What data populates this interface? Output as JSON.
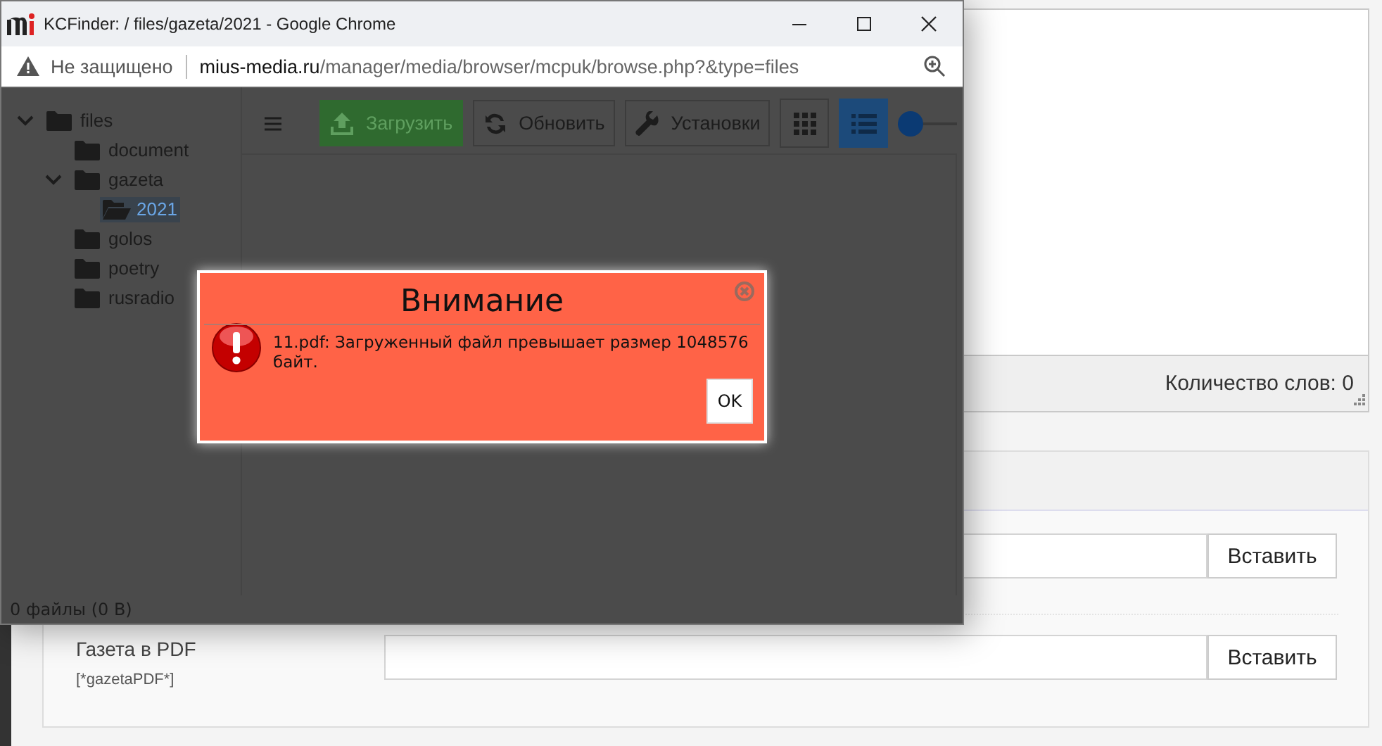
{
  "page": {
    "word_count": "Количество слов: 0",
    "fields": [
      {
        "button": "Вставить"
      },
      {
        "label": "Газета в PDF",
        "tag": "[*gazetaPDF*]",
        "button": "Вставить"
      }
    ]
  },
  "popup": {
    "title": "KCFinder: / files/gazeta/2021 - Google Chrome",
    "security": "Не защищено",
    "url_host": "mius-media.ru",
    "url_path": "/manager/media/browser/mcpuk/browse.php?&type=files",
    "tree": [
      {
        "label": "files",
        "expanded": true,
        "selected": false,
        "children": [
          {
            "label": "document",
            "selected": false
          },
          {
            "label": "gazeta",
            "expanded": true,
            "selected": false,
            "children": [
              {
                "label": "2021",
                "selected": true
              }
            ]
          },
          {
            "label": "golos",
            "selected": false
          },
          {
            "label": "poetry",
            "selected": false
          },
          {
            "label": "rusradio",
            "selected": false
          }
        ]
      }
    ],
    "toolbar": [
      {
        "kind": "menu"
      },
      {
        "kind": "upload",
        "label": "Загрузить"
      },
      {
        "kind": "refresh",
        "label": "Обновить"
      },
      {
        "kind": "settings",
        "label": "Установки"
      },
      {
        "kind": "thumbs",
        "selected": false
      },
      {
        "kind": "list",
        "selected": true
      },
      {
        "kind": "slider",
        "level": 0
      }
    ],
    "status": "0 файлы (0 B)",
    "dialog": {
      "title": "Внимание",
      "message": "11.pdf: Загруженный файл превышает размер 1048576 байт.",
      "button": "OK"
    }
  }
}
